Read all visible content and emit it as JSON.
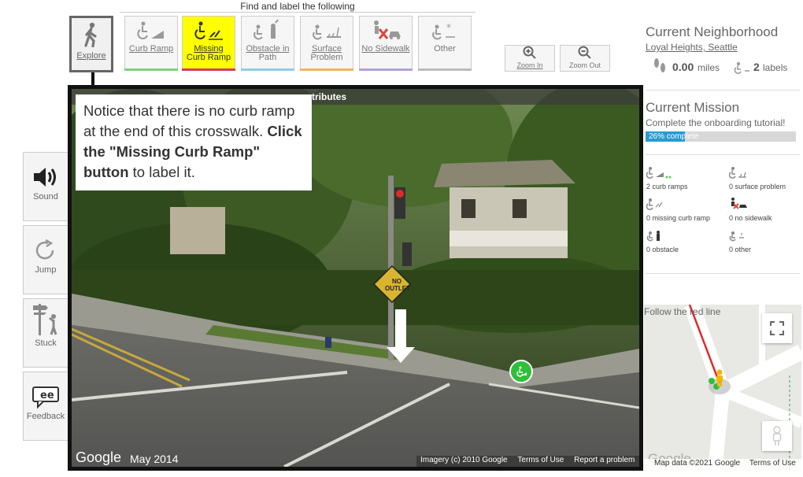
{
  "toolbar": {
    "title": "Find and label the following",
    "explore": "Explore",
    "tools": [
      {
        "name": "curb-ramp",
        "l1": "Curb Ramp",
        "l2": "",
        "color": "#7ed37e"
      },
      {
        "name": "missing-curb-ramp",
        "l1": "Missing",
        "l2": "Curb Ramp",
        "color": "#d63a6a"
      },
      {
        "name": "obstacle",
        "l1": "Obstacle in",
        "l2": "Path",
        "color": "#8ccfe6"
      },
      {
        "name": "surface-problem",
        "l1": "Surface",
        "l2": "Problem",
        "color": "#f3b45a"
      },
      {
        "name": "no-sidewalk",
        "l1": "No Sidewalk",
        "l2": "",
        "color": "#b3a2d8"
      },
      {
        "name": "other",
        "l1": "Other",
        "l2": "",
        "color": "#bbbbbb"
      }
    ],
    "zoom_in": "Zoom In",
    "zoom_out": "Zoom Out"
  },
  "side_buttons": [
    "Sound",
    "Jump",
    "Stuck",
    "Feedback"
  ],
  "pano": {
    "attribution_partial": "tributes",
    "callout": {
      "text1": "Notice that there is no curb ramp at the end of this crosswalk. ",
      "bold": "Click the \"Missing Curb Ramp\" button",
      "text2": " to label it."
    },
    "sign_text": "NO OUTLET",
    "google": "Google",
    "date": "May 2014",
    "footer": {
      "imagery": "Imagery (c) 2010 Google",
      "terms": "Terms of Use",
      "report": "Report a problem"
    }
  },
  "right": {
    "neighborhood_title": "Current Neighborhood",
    "neighborhood_link": "Loyal Heights, Seattle",
    "miles": "0.00",
    "miles_unit": "miles",
    "labels_count": "2",
    "labels_unit": "labels",
    "mission_title": "Current Mission",
    "mission_text": "Complete the onboarding tutorial!",
    "progress_pct": 26,
    "progress_label": "26% complete",
    "stats": [
      "2 curb ramps",
      "0 surface problem",
      "0 missing curb ramp",
      "0 no sidewalk",
      "0 obstacle",
      "0 other"
    ],
    "map_hint": "Follow the red line",
    "map_attrib": "Map data ©2021 Google",
    "map_terms": "Terms of Use",
    "map_google": "Google"
  },
  "colors": {
    "accent": "#ffff00",
    "progress": "#2a9ad0"
  }
}
